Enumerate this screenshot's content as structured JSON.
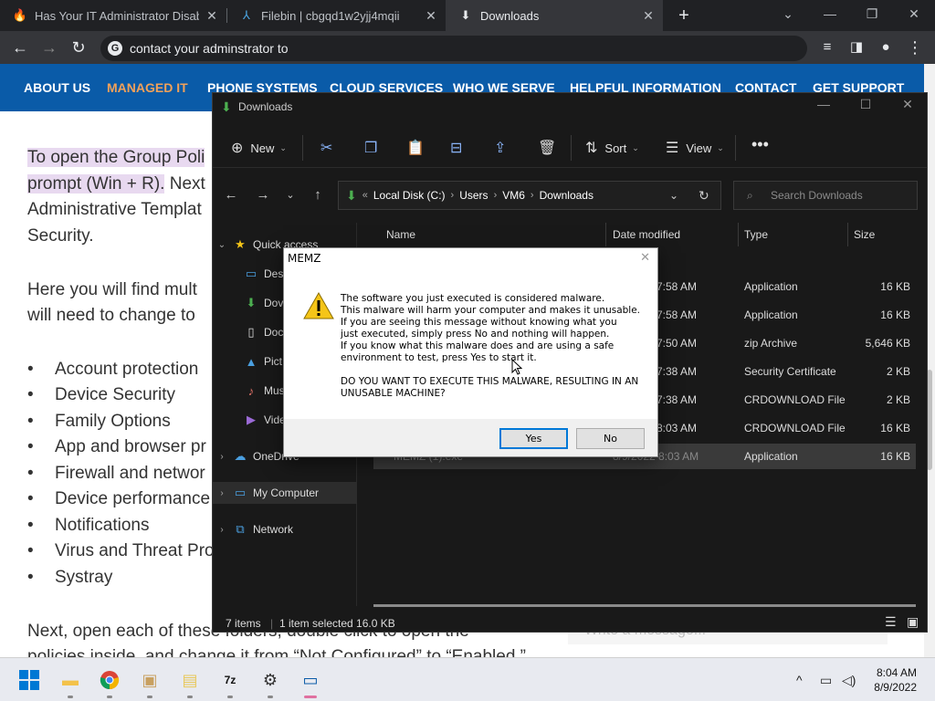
{
  "browser": {
    "tabs": [
      {
        "title": "Has Your IT Administrator Disable",
        "favicon": "flame-icon",
        "active": false
      },
      {
        "title": "Filebin | cbgqd1w2yjj4mqii",
        "favicon": "bin-icon",
        "active": false
      },
      {
        "title": "Downloads",
        "favicon": "download-icon",
        "active": true
      }
    ],
    "address": "contact your adminstrator to"
  },
  "page": {
    "nav": [
      "ABOUT US",
      "MANAGED IT",
      "PHONE SYSTEMS",
      "CLOUD SERVICES",
      "WHO WE SERVE",
      "HELPFUL INFORMATION",
      "CONTACT",
      "GET SUPPORT"
    ],
    "nav_selected": "MANAGED IT",
    "p1_line1": "To open the Group Poli",
    "p1_line2a": "prompt (Win + R).",
    "p1_line2b": " Next",
    "p1_line3": "Administrative Templat",
    "p1_line4": "Security.",
    "p2_line1": "Here you will find mult",
    "p2_line2": "will need to change to",
    "bullets": [
      "Account protection",
      "Device Security",
      "Family Options",
      "App and browser pr",
      "Firewall and networ",
      "Device performance",
      "Notifications",
      "Virus and Threat Pro",
      "Systray"
    ],
    "p3_line1": "Next, open each of these folders, double click to open the",
    "p3_line2": "policies inside, and change it from “Not Configured” to “Enabled.”",
    "chat_placeholder": "Write a message..."
  },
  "explorer": {
    "title": "Downloads",
    "commands": {
      "new": "New",
      "sort": "Sort",
      "view": "View"
    },
    "breadcrumb": [
      "Local Disk (C:)",
      "Users",
      "VM6",
      "Downloads"
    ],
    "search_placeholder": "Search Downloads",
    "sidebar": [
      {
        "label": "Quick access",
        "icon": "star-icon",
        "expanded": true
      },
      {
        "label": "Des",
        "icon": "desktop-icon"
      },
      {
        "label": "Dov",
        "icon": "download-icon"
      },
      {
        "label": "Doc",
        "icon": "document-icon"
      },
      {
        "label": "Pict",
        "icon": "pictures-icon"
      },
      {
        "label": "Mus",
        "icon": "music-icon"
      },
      {
        "label": "Vide",
        "icon": "video-icon"
      },
      {
        "label": "OneDrive",
        "icon": "cloud-icon"
      },
      {
        "label": "My Computer",
        "icon": "computer-icon"
      },
      {
        "label": "Network",
        "icon": "network-icon"
      }
    ],
    "columns": [
      "Name",
      "Date modified",
      "Type",
      "Size"
    ],
    "rows": [
      {
        "date": "7:58 AM",
        "type": "Application",
        "size": "16 KB"
      },
      {
        "date": "7:58 AM",
        "type": "Application",
        "size": "16 KB"
      },
      {
        "date": "7:50 AM",
        "type": "zip Archive",
        "size": "5,646 KB"
      },
      {
        "date": "7:38 AM",
        "type": "Security Certificate",
        "size": "2 KB"
      },
      {
        "date": "7:38 AM",
        "type": "CRDOWNLOAD File",
        "size": "2 KB"
      },
      {
        "date": "8:03 AM",
        "type": "CRDOWNLOAD File",
        "size": "16 KB"
      },
      {
        "name": "MEMZ (1).exe",
        "date": "8/9/2022 8:03 AM",
        "type": "Application",
        "size": "16 KB",
        "selected": true
      }
    ],
    "status": {
      "items": "7 items",
      "selected": "1 item selected  16.0 KB"
    }
  },
  "dialog": {
    "title": "MEMZ",
    "message": [
      "The software you just executed is considered malware.",
      "This malware will harm your computer and makes it unusable.",
      "If you are seeing this message without knowing what you",
      "just executed, simply press No and nothing will happen.",
      "If you know what this malware does and are using a safe",
      "environment to test, press Yes to start it.",
      "",
      "DO YOU WANT TO EXECUTE THIS MALWARE, RESULTING IN AN",
      "UNUSABLE MACHINE?"
    ],
    "yes": "Yes",
    "no": "No"
  },
  "taskbar": {
    "time": "8:04 AM",
    "date": "8/9/2022"
  },
  "colors": {
    "nav_bg": "#0a5ba8",
    "nav_selected": "#f0a15a",
    "highlight": "#e8d9f0"
  }
}
